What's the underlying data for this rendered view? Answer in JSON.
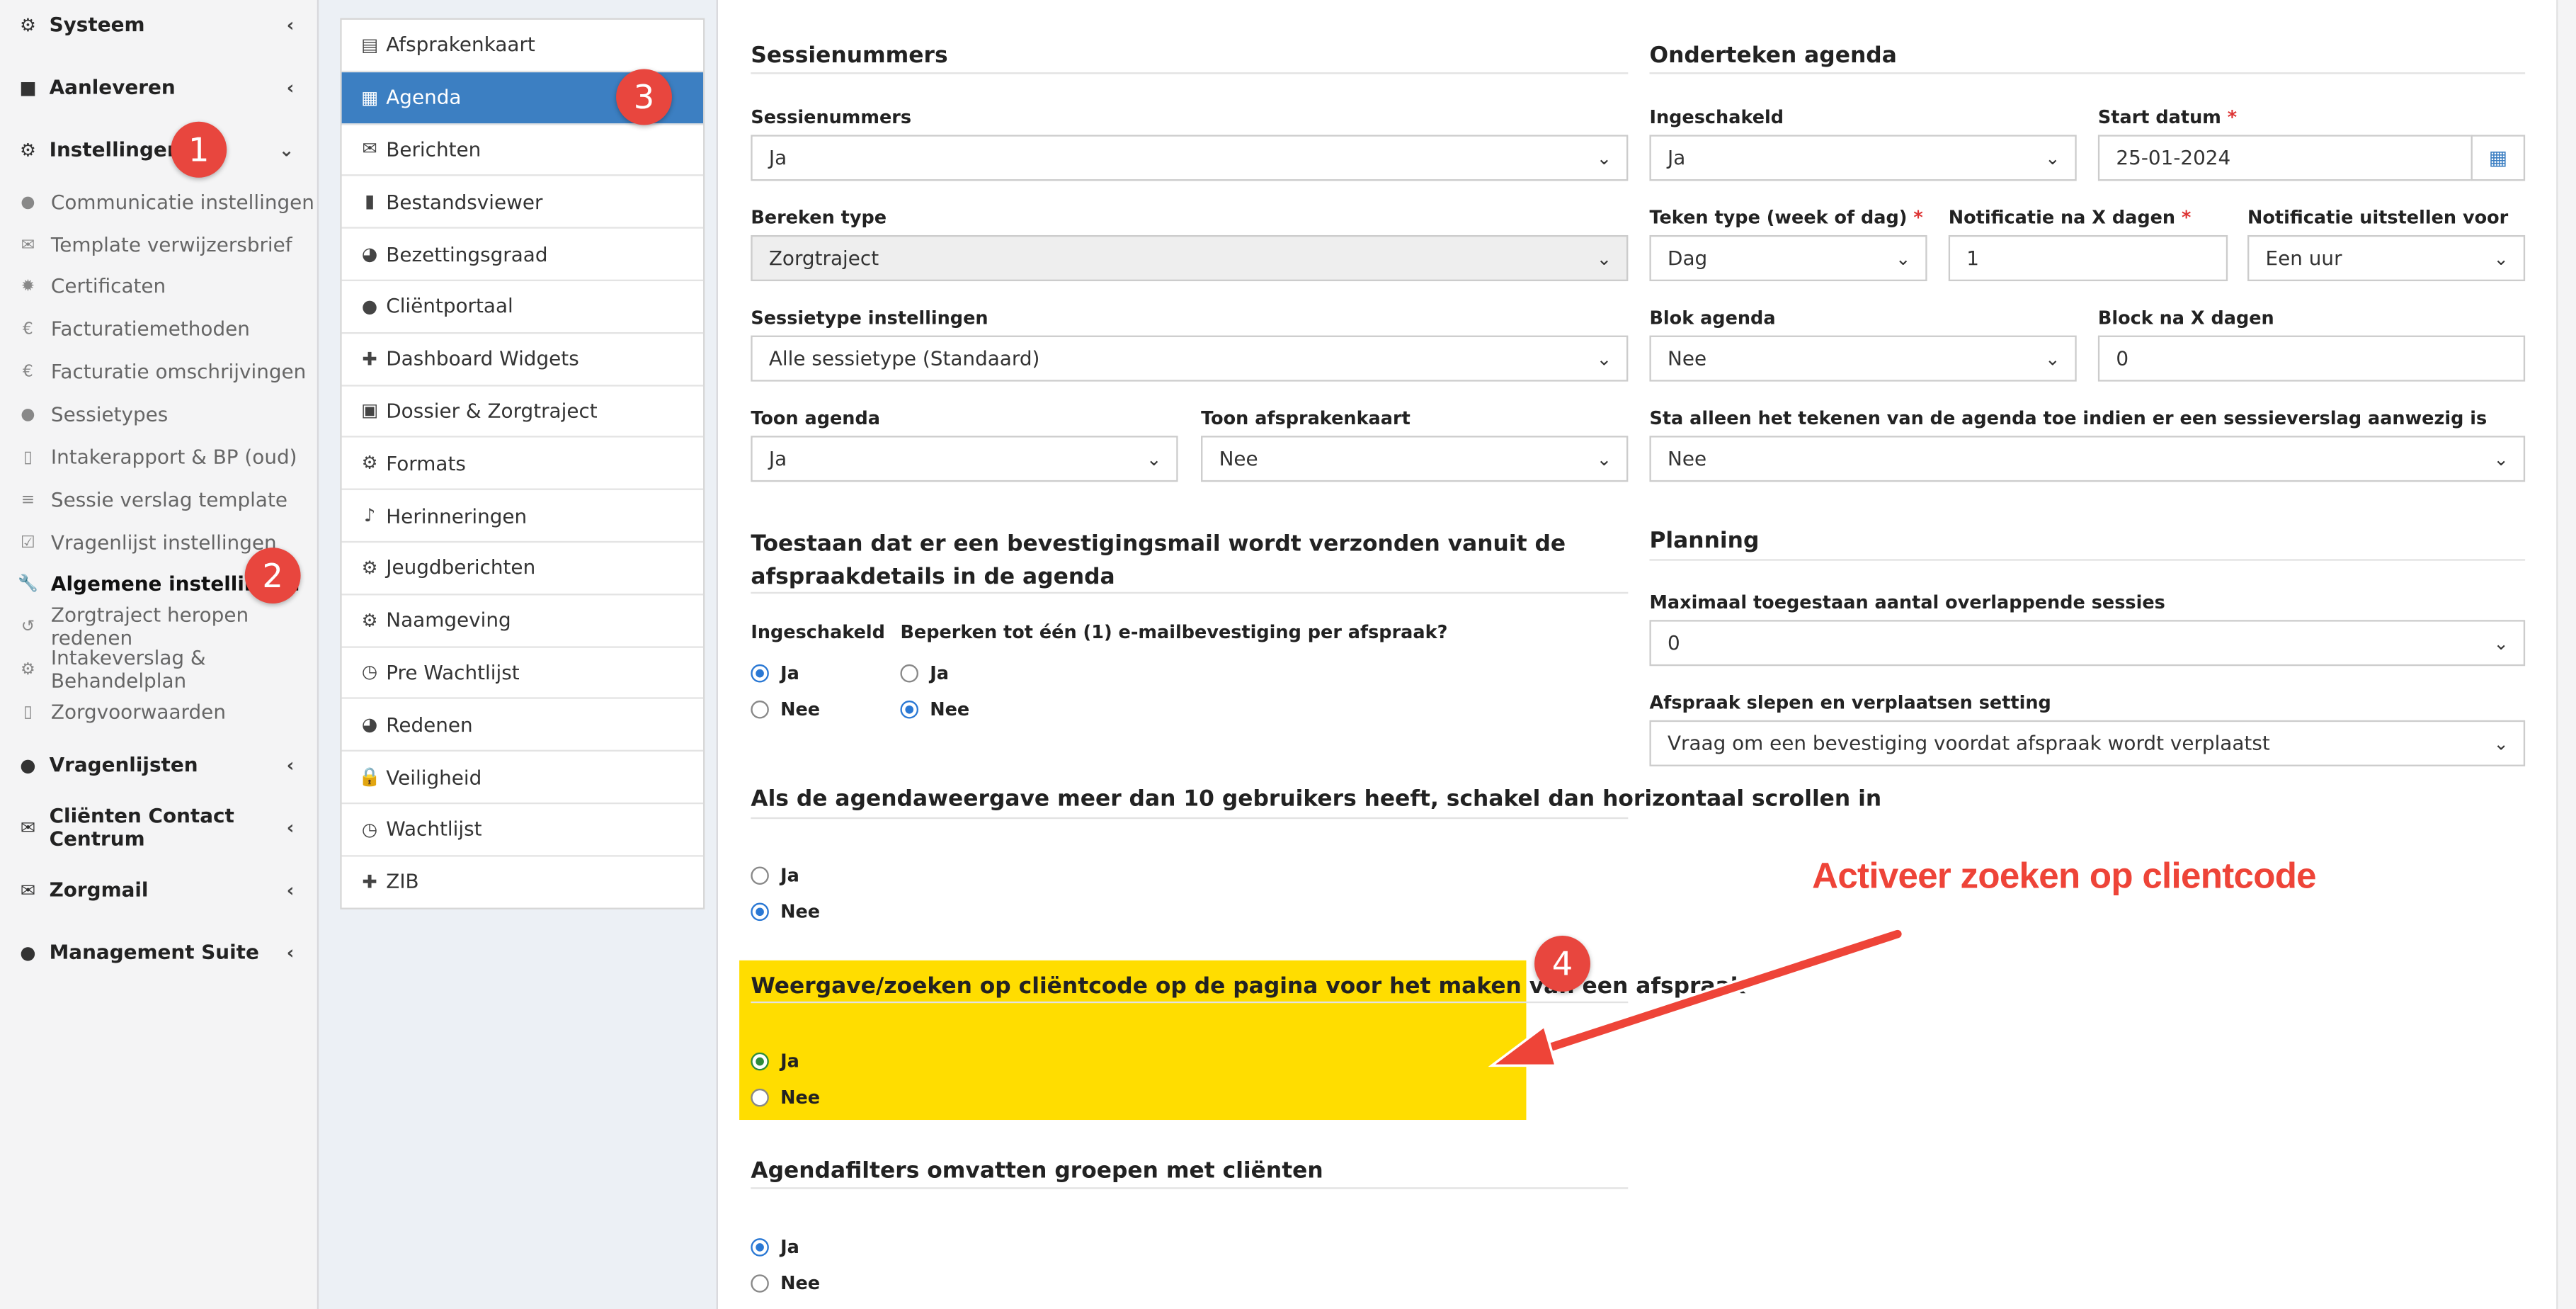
{
  "sidebar": {
    "main_items": [
      {
        "label": "Systeem",
        "icon": "cogs-icon"
      },
      {
        "label": "Aanleveren",
        "icon": "truck-icon"
      },
      {
        "label": "Instellingen",
        "icon": "gear-icon"
      },
      {
        "label": "Vragenlijsten",
        "icon": "globe-icon"
      },
      {
        "label": "Cliënten Contact Centrum",
        "icon": "envelope-icon"
      },
      {
        "label": "Zorgmail",
        "icon": "envelope-icon"
      },
      {
        "label": "Management Suite",
        "icon": "globe-icon"
      }
    ],
    "sub_items": [
      "Communicatie instellingen",
      "Template verwijzersbrief",
      "Certificaten",
      "Facturatiemethoden",
      "Facturatie omschrijvingen",
      "Sessietypes",
      "Intakerapport & BP (oud)",
      "Sessie verslag template",
      "Vragenlijst instellingen",
      "Algemene instellingen",
      "Zorgtraject heropen redenen",
      "Intakeverslag & Behandelplan",
      "Zorgvoorwaarden"
    ]
  },
  "badges": {
    "b1": "1",
    "b2": "2",
    "b3": "3",
    "b4": "4"
  },
  "settings_menu": [
    "Afsprakenkaart",
    "Agenda",
    "Berichten",
    "Bestandsviewer",
    "Bezettingsgraad",
    "Cliëntportaal",
    "Dashboard Widgets",
    "Dossier & Zorgtraject",
    "Formats",
    "Herinneringen",
    "Jeugdberichten",
    "Naamgeving",
    "Pre Wachtlijst",
    "Redenen",
    "Veiligheid",
    "Wachtlijst",
    "ZIB"
  ],
  "sessie": {
    "heading": "Sessienummers",
    "nummers_label": "Sessienummers",
    "nummers_value": "Ja",
    "bereken_label": "Bereken type",
    "bereken_value": "Zorgtraject",
    "sessietype_label": "Sessietype instellingen",
    "sessietype_value": "Alle sessietype (Standaard)",
    "toon_agenda_label": "Toon agenda",
    "toon_agenda_value": "Ja",
    "toon_kaart_label": "Toon afsprakenkaart",
    "toon_kaart_value": "Nee"
  },
  "onderteken": {
    "heading": "Onderteken agenda",
    "ingeschakeld_label": "Ingeschakeld",
    "ingeschakeld_value": "Ja",
    "start_label": "Start datum",
    "start_value": "25-01-2024",
    "teken_label": "Teken type (week of dag)",
    "teken_value": "Dag",
    "notificatie_label": "Notificatie na X dagen",
    "notificatie_value": "1",
    "uitstellen_label": "Notificatie uitstellen voor",
    "uitstellen_value": "Een uur",
    "blok_label": "Blok agenda",
    "blok_value": "Nee",
    "block_dagen_label": "Block na X dagen",
    "block_dagen_value": "0",
    "sta_label": "Sta alleen het tekenen van de agenda toe indien er een sessieverslag aanwezig is",
    "sta_value": "Nee",
    "required_mark": "*"
  },
  "bevestiging": {
    "heading": "Toestaan dat er een bevestigingsmail wordt verzonden vanuit de afspraakdetails in de agenda",
    "ingeschakeld_label": "Ingeschakeld",
    "beperken_label": "Beperken tot één (1) e-mailbevestiging per afspraak?",
    "ja": "Ja",
    "nee": "Nee"
  },
  "planning": {
    "heading": "Planning",
    "overlap_label": "Maximaal toegestaan aantal overlappende sessies",
    "overlap_value": "0",
    "slepen_label": "Afspraak slepen en verplaatsen setting",
    "slepen_value": "Vraag om een bevestiging voordat afspraak wordt verplaatst"
  },
  "scroll": {
    "heading": "Als de agendaweergave meer dan 10 gebruikers heeft, schakel dan horizontaal scrollen in",
    "ja": "Ja",
    "nee": "Nee"
  },
  "clientcode": {
    "heading": "Weergave/zoeken op cliëntcode op de pagina voor het maken van een afspraak",
    "ja": "Ja",
    "nee": "Nee",
    "highlight_color": "#ffdd00"
  },
  "filters": {
    "heading": "Agendafilters omvatten groepen met cliënten",
    "ja": "Ja",
    "nee": "Nee"
  },
  "annotation": {
    "text": "Activeer zoeken op clientcode",
    "color": "#ee4438"
  },
  "colors": {
    "accent": "#3c7fc2",
    "badge": "#e8463e",
    "radio_selected": "#2a78d4"
  }
}
